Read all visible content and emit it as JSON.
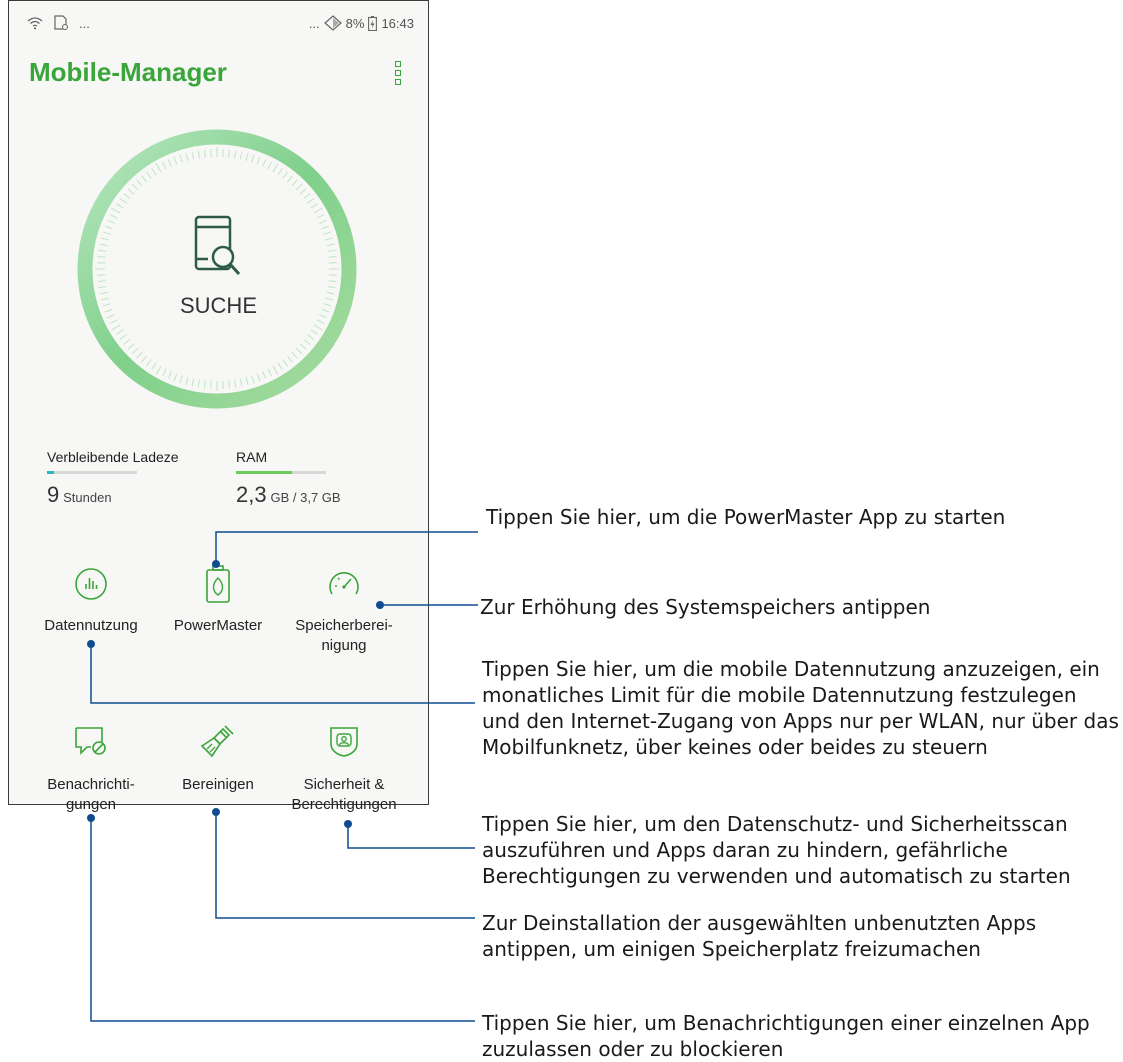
{
  "status_bar": {
    "left_icons": [
      "wifi-icon",
      "sim-icon",
      "more-icon"
    ],
    "more_text": "...",
    "right_prefix": "...",
    "battery_percent": "8%",
    "time": "16:43"
  },
  "header": {
    "title": "Mobile-Manager"
  },
  "gauge": {
    "label": "SUCHE",
    "accent": "#7fd08a"
  },
  "stats": [
    {
      "title": "Verbleibende Ladeze",
      "value": "9",
      "unit": "Stunden",
      "fill_fraction": 0.08,
      "color": "#2ab6c8"
    },
    {
      "title": "RAM",
      "value": "2,3",
      "unit": "GB / 3,7 GB",
      "fill_fraction": 0.62,
      "color": "#6ccb5a"
    }
  ],
  "tiles": [
    {
      "label": "Datennutzung",
      "icon": "data-usage-icon"
    },
    {
      "label": "PowerMaster",
      "icon": "battery-leaf-icon"
    },
    {
      "label_line1": "Speicherberei-",
      "label_line2": "nigung",
      "icon": "speedometer-icon"
    },
    {
      "label_line1": "Benachrichti-",
      "label_line2": "gungen",
      "icon": "notification-block-icon"
    },
    {
      "label": "Bereinigen",
      "icon": "broom-icon"
    },
    {
      "label_line1": "Sicherheit &",
      "label_line2": "Berechtigungen",
      "icon": "shield-user-icon"
    }
  ],
  "annotations": {
    "powermaster": "Tippen Sie hier, um die PowerMaster App zu starten",
    "speicher": "Zur Erhöhung des Systemspeichers antippen",
    "daten_1": "Tippen Sie hier, um die mobile Datennutzung anzuzeigen, ein",
    "daten_2": "monatliches Limit für die mobile Datennutzung festzulegen",
    "daten_3": "und den Internet-Zugang von Apps nur per WLAN, nur über das",
    "daten_4": "Mobilfunknetz, über keines oder beides zu steuern",
    "sicherheit_1": "Tippen Sie hier, um den Datenschutz- und Sicherheitsscan",
    "sicherheit_2": "auszuführen und Apps daran zu hindern, gefährliche",
    "sicherheit_3": "Berechtigungen zu verwenden und automatisch zu starten",
    "bereinigen_1": "Zur Deinstallation der ausgewählten unbenutzten Apps",
    "bereinigen_2": "antippen, um einigen Speicherplatz freizumachen",
    "benachrichtigungen_1": "Tippen Sie hier, um Benachrichtigungen einer einzelnen App",
    "benachrichtigungen_2": "zuzulassen oder zu blockieren"
  },
  "colors": {
    "brand_green": "#3aa53a",
    "callout_blue": "#0f4c8f"
  }
}
